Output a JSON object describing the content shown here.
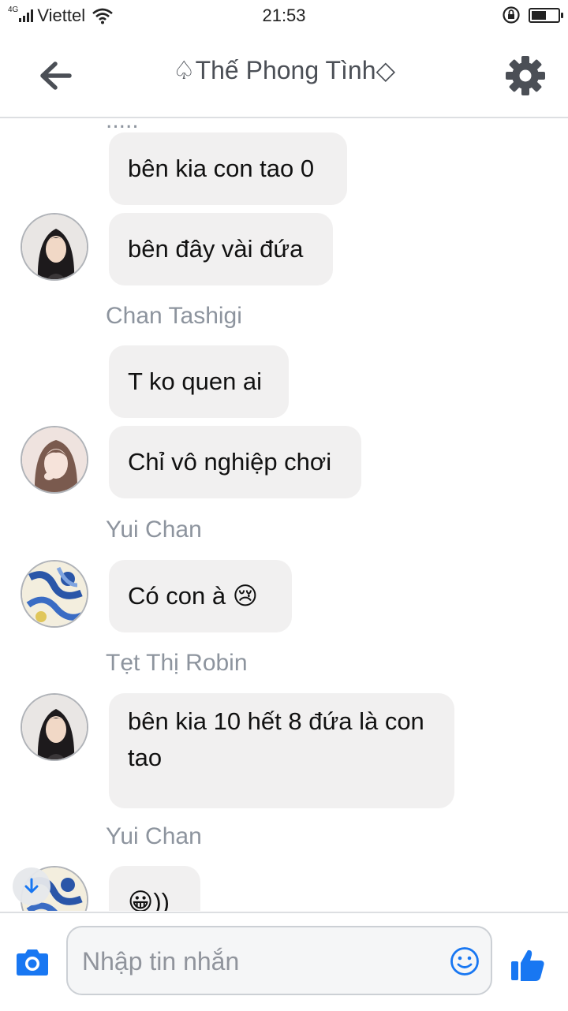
{
  "status_bar": {
    "network_type": "4G",
    "carrier": "Viettel",
    "time": "21:53",
    "battery_level": 0.55
  },
  "header": {
    "title": "♤Thế Phong Tình◇",
    "back_icon": "arrow-left-icon",
    "settings_icon": "gear-icon"
  },
  "chat": {
    "messages": [
      {
        "text": "bên kia con tao 0"
      },
      {
        "text": "bên đây vài đứa"
      },
      {
        "sender": "Chan Tashigi"
      },
      {
        "text": "T ko quen ai"
      },
      {
        "text": "Chỉ vô nghiệp chơi"
      },
      {
        "sender": "Yui Chan"
      },
      {
        "text": "Có con à 😢"
      },
      {
        "sender": "Tẹt Thị Robin"
      },
      {
        "text": "bên kia 10 hết 8 đứa là con tao"
      },
      {
        "sender": "Yui Chan"
      },
      {
        "text": "😀))"
      }
    ]
  },
  "composer": {
    "placeholder": "Nhập tin nhắn",
    "value": "",
    "camera_icon": "camera-icon",
    "emoji_icon": "smiley-icon",
    "like_icon": "thumbs-up-icon"
  },
  "colors": {
    "accent": "#1877f2",
    "bubble": "#f1f0f0",
    "sender_text": "#8d949e"
  }
}
